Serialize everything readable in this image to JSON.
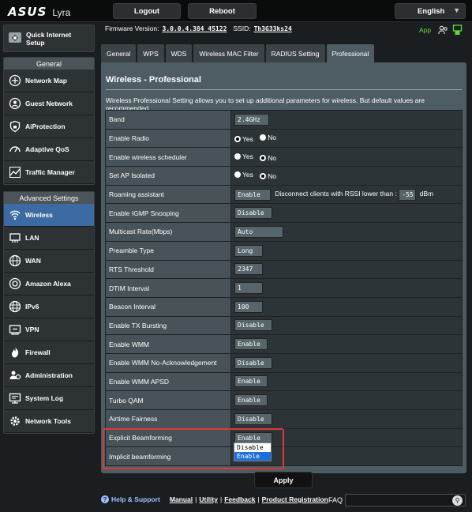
{
  "brand": {
    "logo": "ASUS",
    "model": "Lyra"
  },
  "top": {
    "logout": "Logout",
    "reboot": "Reboot",
    "language": "English"
  },
  "firmware": {
    "label": "Firmware Version:",
    "version": "3.0.0.4.384_45122",
    "ssid_label": "SSID:",
    "ssid": "Th3G33ks24",
    "app": "App"
  },
  "sidebar": {
    "quick": "Quick Internet Setup",
    "general_header": "General",
    "general": [
      {
        "label": "Network Map",
        "icon": "network-map-icon"
      },
      {
        "label": "Guest Network",
        "icon": "guest-network-icon"
      },
      {
        "label": "AiProtection",
        "icon": "shield-lock-icon"
      },
      {
        "label": "Adaptive QoS",
        "icon": "gauge-icon"
      },
      {
        "label": "Traffic Manager",
        "icon": "traffic-manager-icon"
      }
    ],
    "advanced_header": "Advanced Settings",
    "advanced": [
      {
        "label": "Wireless",
        "icon": "wireless-icon",
        "active": true
      },
      {
        "label": "LAN",
        "icon": "lan-icon"
      },
      {
        "label": "WAN",
        "icon": "wan-globe-icon"
      },
      {
        "label": "Amazon Alexa",
        "icon": "alexa-icon"
      },
      {
        "label": "IPv6",
        "icon": "ipv6-globe-icon"
      },
      {
        "label": "VPN",
        "icon": "vpn-icon"
      },
      {
        "label": "Firewall",
        "icon": "firewall-icon"
      },
      {
        "label": "Administration",
        "icon": "administration-icon"
      },
      {
        "label": "System Log",
        "icon": "system-log-icon"
      },
      {
        "label": "Network Tools",
        "icon": "network-tools-icon"
      }
    ]
  },
  "tabs": [
    "General",
    "WPS",
    "WDS",
    "Wireless MAC Filter",
    "RADIUS Setting",
    "Professional"
  ],
  "panel": {
    "title": "Wireless - Professional",
    "desc": "Wireless Professional Setting allows you to set up additional parameters for wireless. But default values are recommended."
  },
  "rows": {
    "band": {
      "label": "Band",
      "value": "2.4GHz"
    },
    "radio": {
      "label": "Enable Radio",
      "yes": "Yes",
      "no": "No"
    },
    "sched": {
      "label": "Enable wireless scheduler",
      "yes": "Yes",
      "no": "No"
    },
    "apiso": {
      "label": "Set AP Isolated",
      "yes": "Yes",
      "no": "No"
    },
    "roam": {
      "label": "Roaming assistant",
      "value": "Enable",
      "text": "Disconnect clients with RSSI lower than :",
      "rssi": "-55",
      "unit": "dBm"
    },
    "igmp": {
      "label": "Enable IGMP Snooping",
      "value": "Disable"
    },
    "mcast": {
      "label": "Multicast Rate(Mbps)",
      "value": "Auto"
    },
    "preamble": {
      "label": "Preamble Type",
      "value": "Long"
    },
    "rts": {
      "label": "RTS Threshold",
      "value": "2347"
    },
    "dtim": {
      "label": "DTIM Interval",
      "value": "1"
    },
    "beacon": {
      "label": "Beacon Interval",
      "value": "100"
    },
    "txburst": {
      "label": "Enable TX Bursting",
      "value": "Disable"
    },
    "wmm": {
      "label": "Enable WMM",
      "value": "Enable"
    },
    "wmmnoack": {
      "label": "Enable WMM No-Acknowledgement",
      "value": "Disable"
    },
    "apsd": {
      "label": "Enable WMM APSD",
      "value": "Enable"
    },
    "turbo": {
      "label": "Turbo QAM",
      "value": "Enable"
    },
    "airtime": {
      "label": "Airtime Fairness",
      "value": "Disable"
    },
    "explicit": {
      "label": "Explicit Beamforming",
      "value": "Enable"
    },
    "implicit": {
      "label": "Implicit beamforming"
    }
  },
  "dropdown": {
    "options": [
      "Disable",
      "Enable"
    ],
    "selected": "Enable"
  },
  "apply": "Apply",
  "footer": {
    "help": "Help & Support",
    "manual": "Manual",
    "utility": "Utility",
    "feedback": "Feedback",
    "product": "Product Registration",
    "faq": "FAQ"
  }
}
